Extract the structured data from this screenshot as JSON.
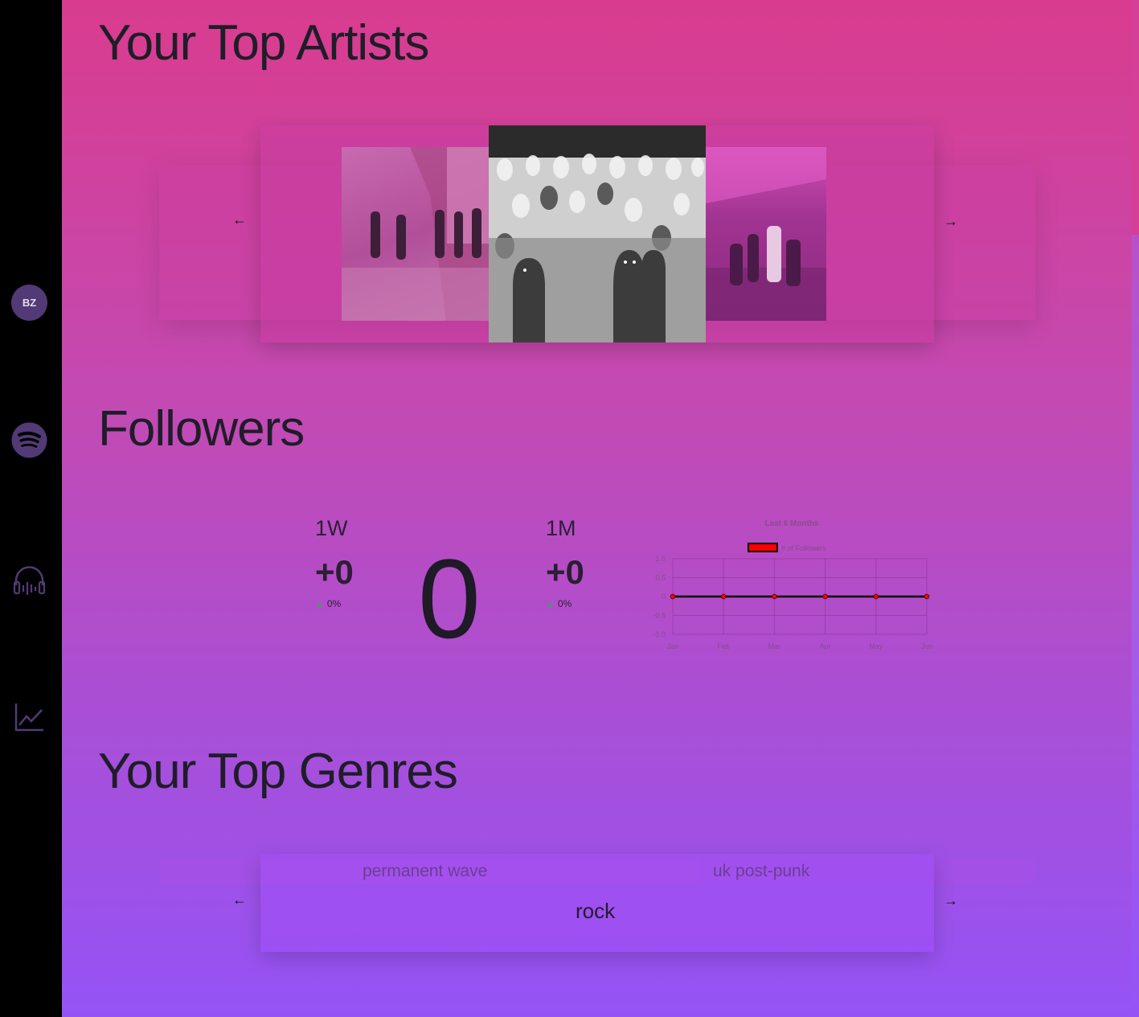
{
  "sidebar": {
    "avatar_initials": "BZ",
    "icons": [
      "spotify-icon",
      "headphones-icon",
      "line-chart-icon"
    ]
  },
  "artists": {
    "heading": "Your Top Artists",
    "prev_label": "←",
    "next_label": "→"
  },
  "followers": {
    "heading": "Followers",
    "week": {
      "label": "1W",
      "value": "+0",
      "pct": "0%"
    },
    "month": {
      "label": "1M",
      "value": "+0",
      "pct": "0%"
    },
    "total": "0",
    "up_symbol": "▲"
  },
  "chart_data": {
    "type": "line",
    "title": "Last 6 Months",
    "categories": [
      "Jan",
      "Feb",
      "Mar",
      "Apr",
      "May",
      "Jun"
    ],
    "series": [
      {
        "name": "# of Followers",
        "values": [
          0,
          0,
          0,
          0,
          0,
          0
        ]
      }
    ],
    "ylim": [
      -1.0,
      1.0
    ],
    "yticks": [
      "1.0",
      "0.5",
      "0",
      "-0.5",
      "-1.0"
    ],
    "grid": true,
    "legend": "top",
    "line_color": "#000000",
    "point_color": "#ff0000"
  },
  "genres": {
    "heading": "Your Top Genres",
    "left": "permanent wave",
    "center": "rock",
    "right": "uk post-punk",
    "prev_label": "←",
    "next_label": "→"
  }
}
